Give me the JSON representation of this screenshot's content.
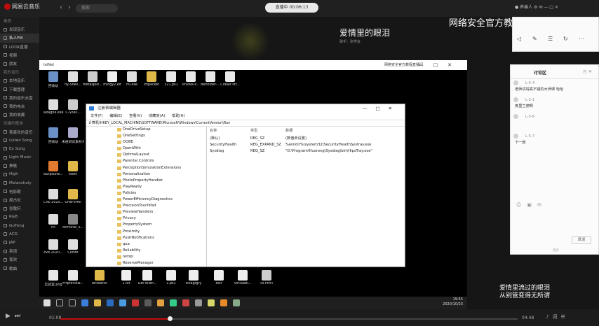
{
  "app": {
    "title": "网易云音乐",
    "search_placeholder": "搜索",
    "live_status": "直播中 00:06:13",
    "user": "养善人",
    "watermark": "网络安全官方教程"
  },
  "sidebar": {
    "items": [
      {
        "label": "推荐",
        "head": true
      },
      {
        "label": "发现音乐"
      },
      {
        "label": "私人FM",
        "active": true
      },
      {
        "label": "LOOK直播"
      },
      {
        "label": "视频"
      },
      {
        "label": "朋友"
      },
      {
        "label": "我的音乐",
        "head": true
      },
      {
        "label": "本地音乐"
      },
      {
        "label": "下载管理"
      },
      {
        "label": "我的音乐云盘"
      },
      {
        "label": "我的电台"
      },
      {
        "label": "我的收藏"
      },
      {
        "label": "创建的歌单",
        "head": true
      },
      {
        "label": "我喜欢的音乐"
      },
      {
        "label": "Listen Song"
      },
      {
        "label": "Ex Song"
      },
      {
        "label": "Light Music"
      },
      {
        "label": "黑歌"
      },
      {
        "label": "High"
      },
      {
        "label": "Melancholy"
      },
      {
        "label": "电影歌"
      },
      {
        "label": "周杰伦"
      },
      {
        "label": "张敬轩"
      },
      {
        "label": "R&B"
      },
      {
        "label": "GuFeng"
      },
      {
        "label": "ACG"
      },
      {
        "label": "JAP"
      },
      {
        "label": "英语"
      },
      {
        "label": "喜欢"
      },
      {
        "label": "歌曲"
      }
    ]
  },
  "song": {
    "title": "爱情里的眼泪",
    "subtitle": "歌手：张学友"
  },
  "lyrics": {
    "line1": "爱情里流过的眼泪",
    "line2": "从别管变得无所谓"
  },
  "player": {
    "current_time": "01:08",
    "total_time": "04:48",
    "progress": 0.24
  },
  "desktop": {
    "window_title": "网络安全官方教程直播间",
    "tab_label": "telNet",
    "icons": [
      {
        "label": "回收站",
        "color": "#6b8fc7"
      },
      {
        "label": "fly-Shell...",
        "color": "#ddd"
      },
      {
        "label": "metasploi...",
        "color": "#ccc"
      },
      {
        "label": "mingy2.elf",
        "color": "#eee"
      },
      {
        "label": "mi.exe",
        "color": "#ddd"
      },
      {
        "label": "impacket",
        "color": "#e0b84a"
      },
      {
        "label": "321.ps1",
        "color": "#e8e8e8"
      },
      {
        "label": "Invoke-P...",
        "color": "#e8e8e8"
      },
      {
        "label": "Beholder-...",
        "color": "#e8e8e8"
      },
      {
        "label": "Cobalt str...",
        "color": "#e8e8e8"
      },
      {
        "label": "lazagne.exe",
        "color": "#ddd"
      },
      {
        "label": "C-Shell...",
        "color": "#ccc"
      },
      {
        "label": "回收站",
        "color": "#6b8fc7"
      },
      {
        "label": "未通测试素材大师.png",
        "color": "#aac"
      },
      {
        "label": "Burpsuite...",
        "color": "#e07a30"
      },
      {
        "label": "tools",
        "color": "#e0b84a"
      },
      {
        "label": "CVE-2020...",
        "color": "#ddd"
      },
      {
        "label": "OneForAll",
        "color": "#e0b84a"
      },
      {
        "label": "nc",
        "color": "#ddd"
      },
      {
        "label": "terminal_s...",
        "color": "#888"
      },
      {
        "label": "cve-2020...",
        "color": "#ddd"
      },
      {
        "label": "Cknife",
        "color": "#ddd"
      },
      {
        "label": "实验室.png",
        "color": "#e8e8e8"
      },
      {
        "label": "FHpreview...",
        "color": "#e8e8e8"
      },
      {
        "label": "dirsearch",
        "color": "#e0b84a"
      },
      {
        "label": "1.txt",
        "color": "#eee"
      },
      {
        "label": "Get-Wlan...",
        "color": "#eee"
      },
      {
        "label": "1.ps1",
        "color": "#eee"
      },
      {
        "label": "sctagtgry",
        "color": "#eee"
      },
      {
        "label": "exit",
        "color": "#eee"
      },
      {
        "label": "VirtualBi...",
        "color": "#eee"
      },
      {
        "label": "cs.html",
        "color": "#ccc"
      }
    ],
    "clock_time": "19:55",
    "clock_date": "2020/10/23"
  },
  "regedit": {
    "title": "注册表编辑器",
    "menu": [
      "文件(F)",
      "编辑(E)",
      "查看(V)",
      "收藏夹(A)",
      "帮助(H)"
    ],
    "address": "计算机\\HKEY_LOCAL_MACHINE\\SOFTWARE\\Microsoft\\Windows\\CurrentVersion\\Run",
    "tree": [
      "OneDriveSetup",
      "OneSettings",
      "OOBE",
      "OpenWith",
      "OptimalLayout",
      "Parental Controls",
      "PerceptionSimulationExtensions",
      "Personalization",
      "PhotoPropertyHandler",
      "PlayReady",
      "Policies",
      "PowerEfficiencyDiagnostics",
      "PrecisionTouchPad",
      "PreviewHandlers",
      "Privacy",
      "PropertySystem",
      "Proximity",
      "PushNotifications",
      "qua",
      "Reliability",
      "rempl",
      "ReserveManager",
      "RetailDemo",
      "Run",
      "RunOnce",
      "Search",
      "SecondaryAuthFactor"
    ],
    "columns": [
      "名称",
      "类型",
      "数据"
    ],
    "rows": [
      {
        "name": "(默认)",
        "type": "REG_SZ",
        "data": "(数值未设置)"
      },
      {
        "name": "SecurityHealth",
        "type": "REG_EXPAND_SZ",
        "data": "%windir%\\system32\\SecurityHealthSystray.exe"
      },
      {
        "name": "Sysdiag",
        "type": "REG_SZ",
        "data": "\"D:\\Program\\Huorong\\Sysdiag\\bin\\HipsTray.exe\""
      }
    ]
  },
  "chat": {
    "tab": "讨论区",
    "messages": [
      {
        "user": "L-5-4",
        "text": "老师讲得真不错的大师课  哈哈"
      },
      {
        "user": "L-2-1",
        "text": "奥里兰德啊"
      },
      {
        "user": "L-5-6",
        "text": ""
      },
      {
        "user": "L-5-7",
        "text": "下一篇"
      }
    ],
    "send": "发送",
    "footer": "更多"
  }
}
